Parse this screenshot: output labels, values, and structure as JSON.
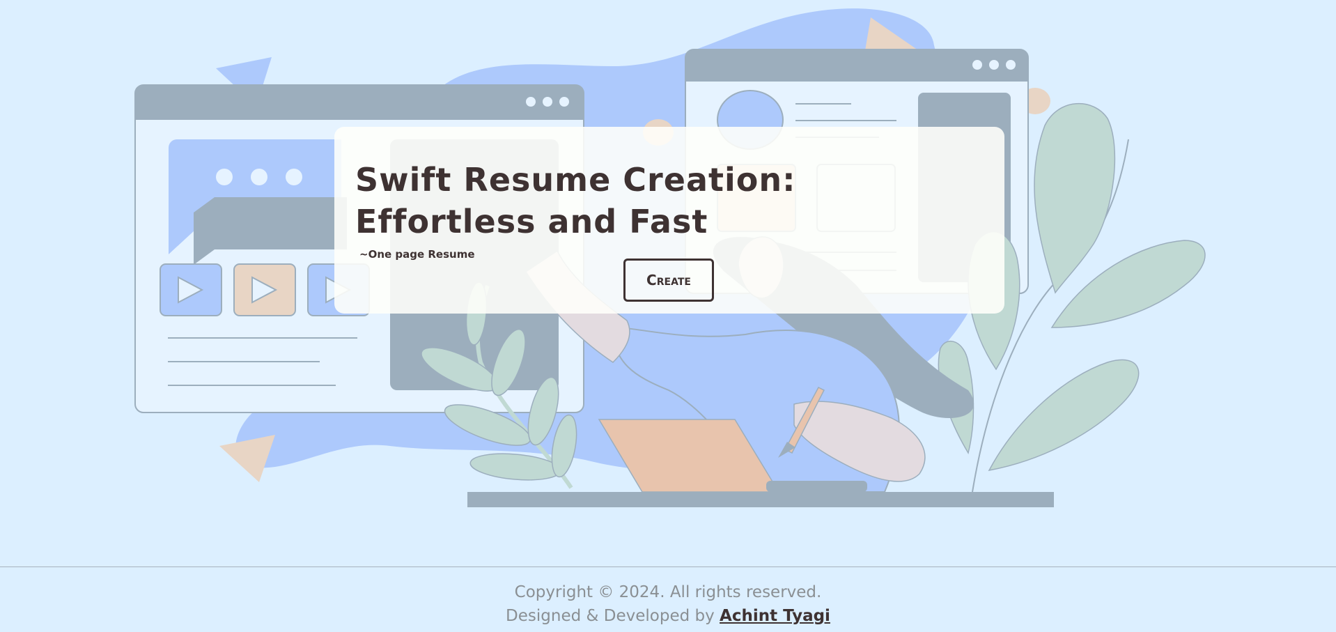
{
  "hero": {
    "title": "Swift Resume Creation: Effortless and Fast",
    "subtitle": "~One page Resume",
    "create_label": "Create"
  },
  "footer": {
    "copyright": "Copyright © 2024. All rights reserved.",
    "designed_by": "Designed & Developed by",
    "author": "Achint Tyagi"
  },
  "colors": {
    "background": "#dcefff",
    "accent_blue": "#adc9fc",
    "slate": "#9caebd",
    "peach": "#e8d5c5",
    "leaf": "#c0d9d3",
    "text_dark": "#3e3232"
  }
}
